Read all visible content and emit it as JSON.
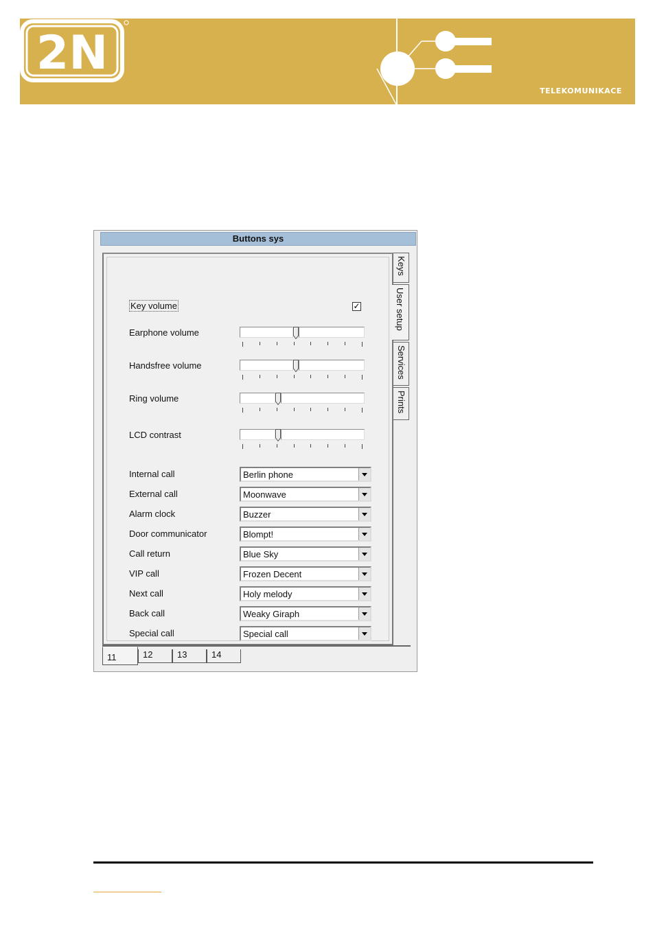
{
  "brand": {
    "logo_text": "2N",
    "caption": "TELEKOMUNIKACE",
    "banner_color": "#d8b14f"
  },
  "dialog": {
    "title": "Buttons sys",
    "key_volume": {
      "label": "Key volume",
      "checked": true,
      "check_glyph": "✓"
    },
    "sliders": [
      {
        "label": "Earphone volume",
        "level": 0.45
      },
      {
        "label": "Handsfree volume",
        "level": 0.45
      },
      {
        "label": "Ring volume",
        "level": 0.3
      },
      {
        "label": "LCD contrast",
        "level": 0.3
      }
    ],
    "combos": [
      {
        "label": "Internal call",
        "value": "Berlin phone"
      },
      {
        "label": "External call",
        "value": "Moonwave"
      },
      {
        "label": "Alarm clock",
        "value": "Buzzer"
      },
      {
        "label": "Door communicator",
        "value": "Blompt!"
      },
      {
        "label": "Call return",
        "value": "Blue Sky"
      },
      {
        "label": "VIP call",
        "value": "Frozen Decent"
      },
      {
        "label": "Next call",
        "value": "Holy melody"
      },
      {
        "label": "Back call",
        "value": "Weaky Giraph"
      },
      {
        "label": "Special call",
        "value": "Special call"
      }
    ],
    "side_tabs": [
      {
        "label": "Keys",
        "active": false
      },
      {
        "label": "User setup",
        "active": true
      },
      {
        "label": "Services",
        "active": false
      },
      {
        "label": "Prints",
        "active": false
      }
    ],
    "bottom_tabs": [
      {
        "label": "11",
        "active": true
      },
      {
        "label": "12",
        "active": false
      },
      {
        "label": "13",
        "active": false
      },
      {
        "label": "14",
        "active": false
      }
    ]
  }
}
